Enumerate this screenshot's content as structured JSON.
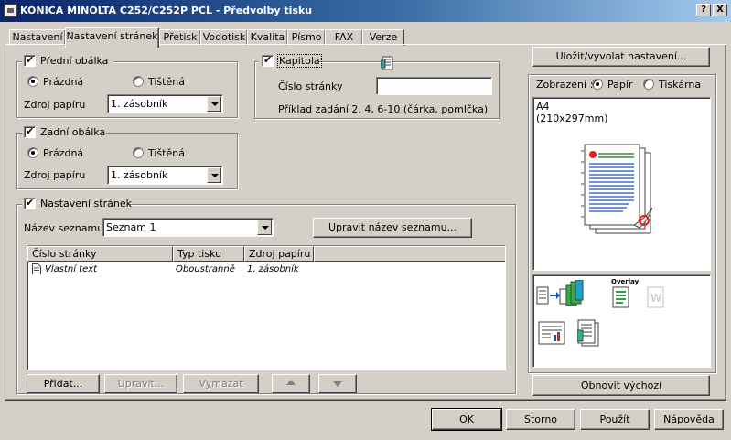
{
  "window": {
    "title": "KONICA MINOLTA C252/C252P PCL - Předvolby tisku",
    "help_btn": "?",
    "close_btn": "X"
  },
  "tabs": [
    {
      "label": "Nastavení",
      "active": false
    },
    {
      "label": "Nastavení stránek",
      "active": true
    },
    {
      "label": "Přetisk",
      "active": false
    },
    {
      "label": "Vodotisk",
      "active": false
    },
    {
      "label": "Kvalita",
      "active": false
    },
    {
      "label": "Písmo",
      "active": false
    },
    {
      "label": "FAX",
      "active": false
    },
    {
      "label": "Verze",
      "active": false
    }
  ],
  "front_cover": {
    "label": "Přední obálka",
    "checked": true,
    "radio_blank": "Prázdná",
    "radio_printed": "Tištěná",
    "selected": "Prázdná",
    "source_label": "Zdroj papíru",
    "source_value": "1. zásobník"
  },
  "chapter": {
    "label": "Kapitola",
    "checked": true,
    "page_number_label": "Číslo stránky",
    "page_number_value": "",
    "example": "Příklad zadání 2, 4, 6-10 (čárka, pomlčka)"
  },
  "back_cover": {
    "label": "Zadní obálka",
    "checked": true,
    "radio_blank": "Prázdná",
    "radio_printed": "Tištěná",
    "selected": "Prázdná",
    "source_label": "Zdroj papíru",
    "source_value": "1. zásobník"
  },
  "page_settings": {
    "label": "Nastavení stránek",
    "checked": true,
    "list_name_label": "Název seznamu",
    "list_name_value": "Seznam 1",
    "edit_list_btn": "Upravit název seznamu...",
    "columns": [
      "Číslo stránky",
      "Typ tisku",
      "Zdroj papíru"
    ],
    "rows": [
      {
        "page": "Vlastní text",
        "type": "Oboustranně",
        "source": "1. zásobník"
      }
    ],
    "add_btn": "Přidat...",
    "edit_btn": "Upravit...",
    "delete_btn": "Vymazat"
  },
  "right_panel": {
    "save_btn": "Uložit/vyvolat nastavení...",
    "view_label": "Zobrazení :",
    "view_paper": "Papír",
    "view_printer": "Tiskárna",
    "view_selected": "Papír",
    "paper_size": "A4",
    "paper_dims": "(210x297mm)",
    "overlay_label": "Overlay",
    "restore_btn": "Obnovit výchozí"
  },
  "footer": {
    "ok": "OK",
    "cancel": "Storno",
    "apply": "Použít",
    "help": "Nápověda"
  },
  "colors": {
    "titlebar_start": "#0a246a",
    "titlebar_end": "#a6caf0",
    "face": "#d4d0c8"
  }
}
